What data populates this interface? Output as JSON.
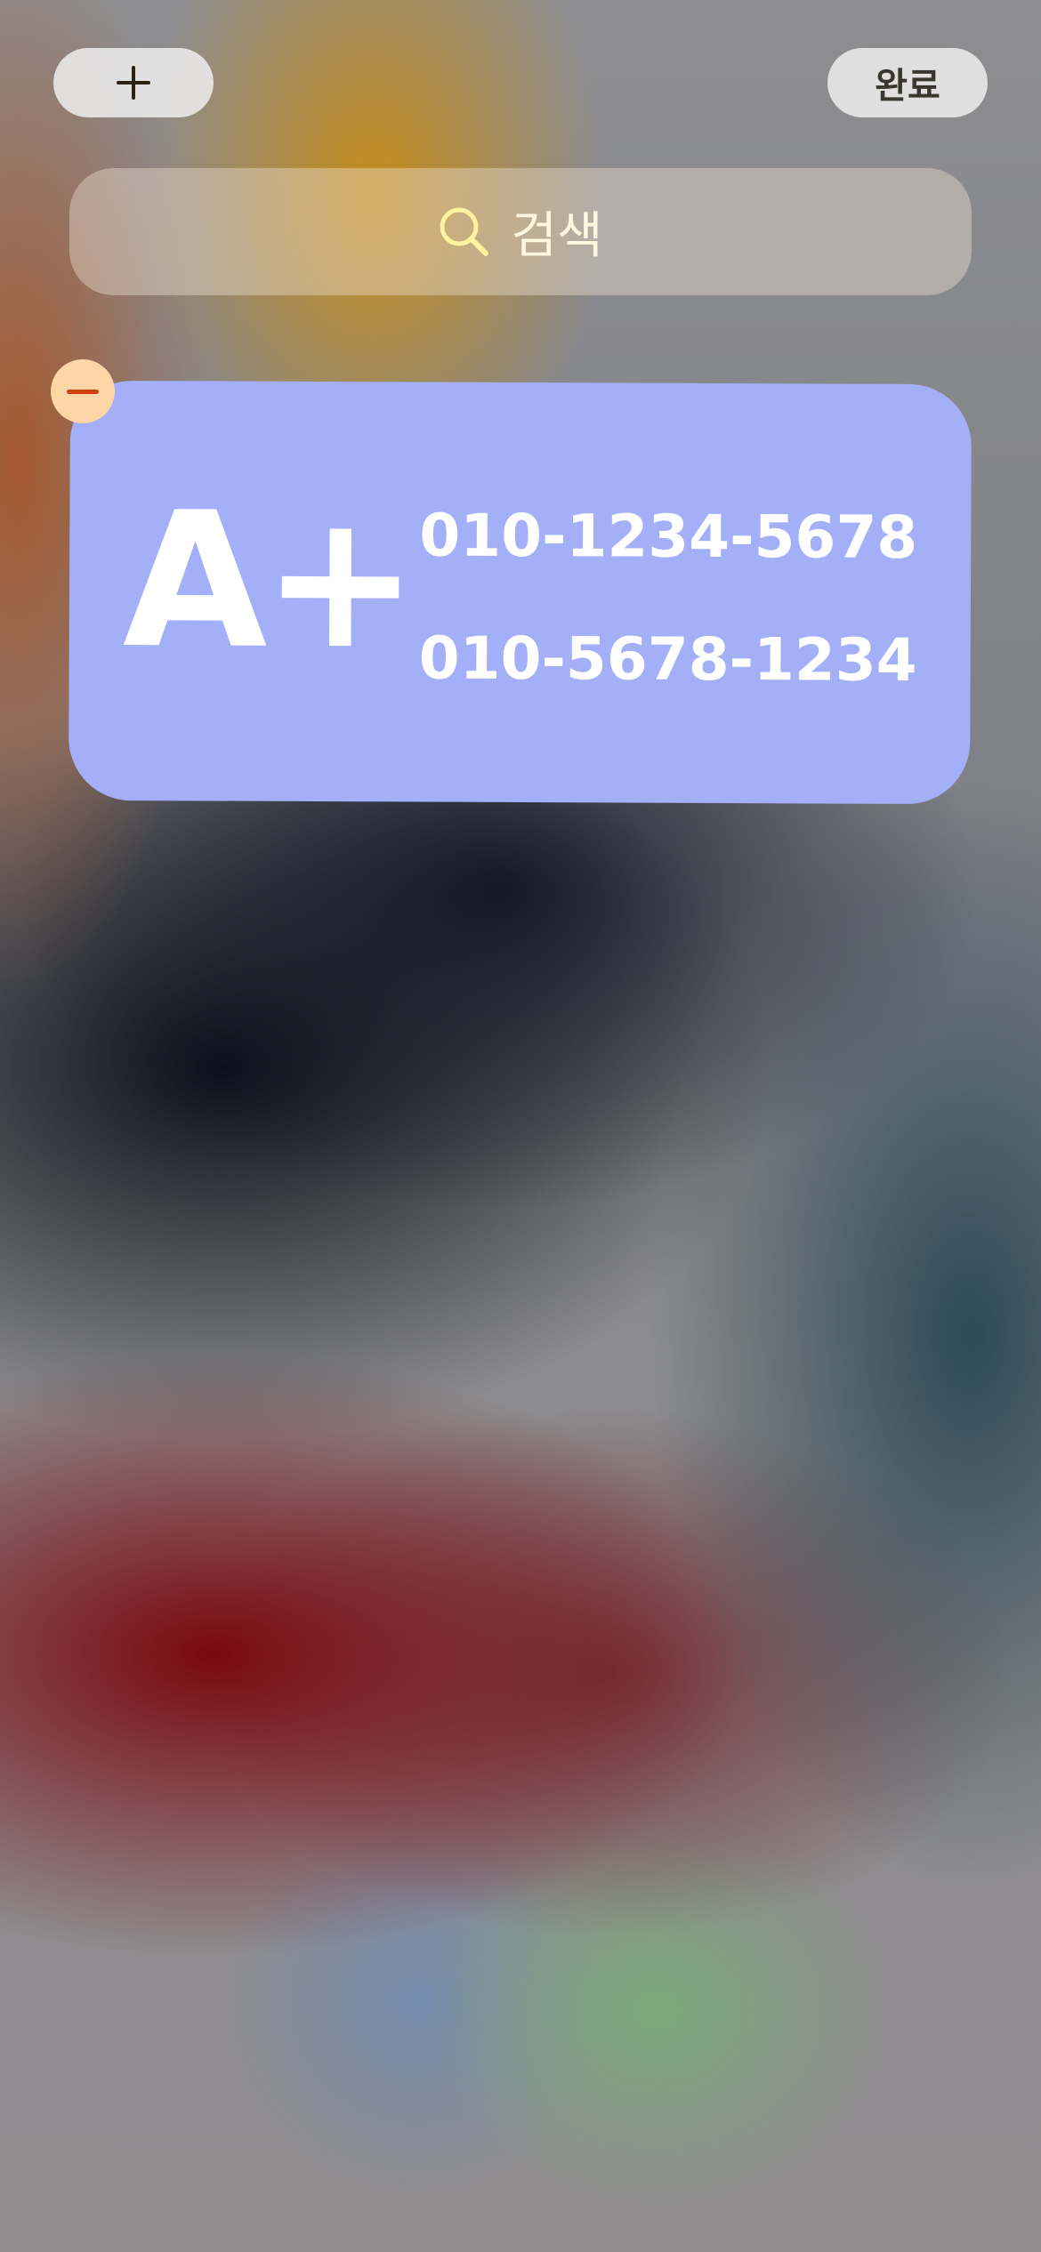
{
  "colors": {
    "widget_background": "#a3b0f8",
    "remove_badge": "#fdd6a8",
    "remove_minus": "#d0400f",
    "search_icon": "#fff3a0"
  },
  "toolbar": {
    "add_icon": "plus-icon",
    "done_label": "완료"
  },
  "search": {
    "icon": "search-icon",
    "label": "검색"
  },
  "widget": {
    "remove_icon": "minus-icon",
    "grade": "A+",
    "phones": [
      "010-1234-5678",
      "010-5678-1234"
    ]
  }
}
